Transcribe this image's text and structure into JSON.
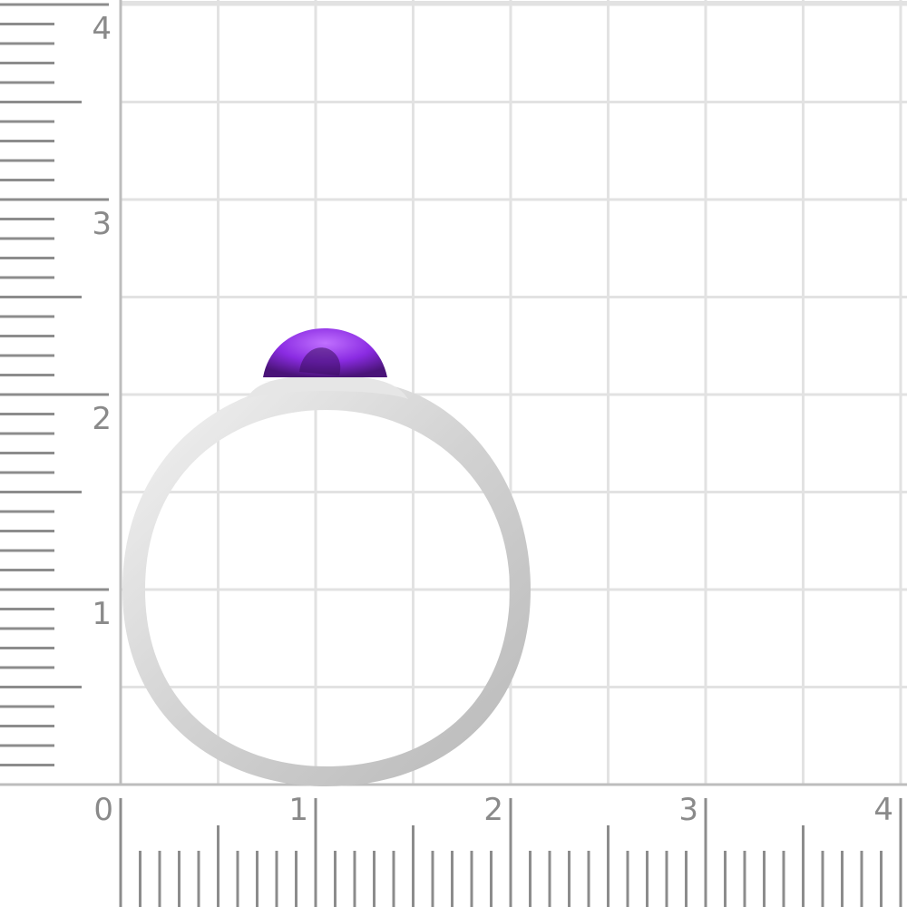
{
  "scale": {
    "unit_labels_x": [
      "0",
      "1",
      "2",
      "3",
      "4"
    ],
    "unit_labels_y": [
      "1",
      "2",
      "3",
      "4"
    ],
    "subdivisions_per_unit": 10,
    "ruler_color": "#8c8c8c",
    "grid_color": "#e2e2e2"
  },
  "subject": {
    "item": "ring",
    "band_color": "#d6d6d6",
    "stone_color": "#8a2be2",
    "stone_dark_color": "#5a1a8c"
  }
}
